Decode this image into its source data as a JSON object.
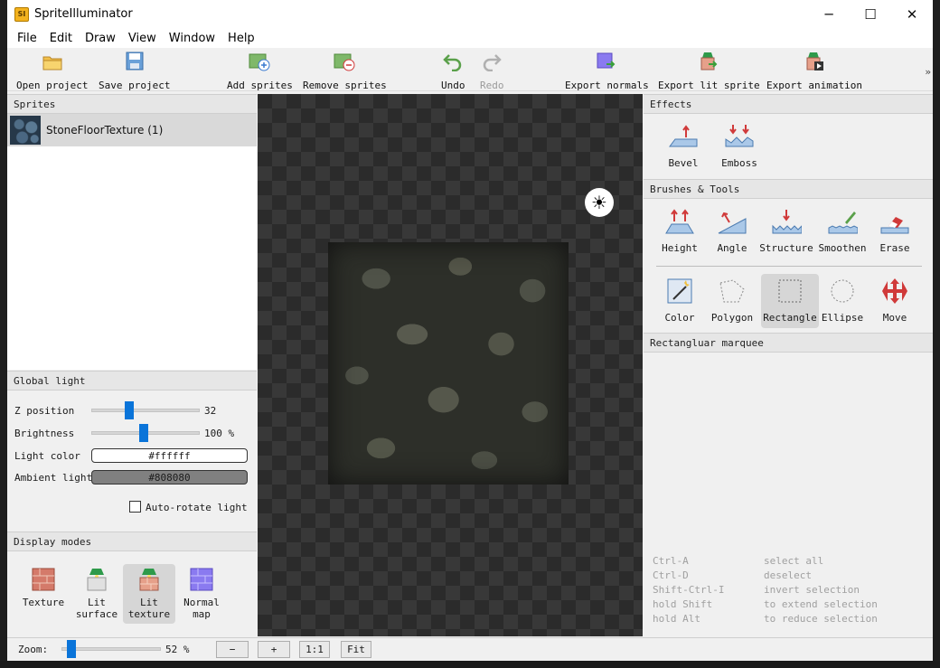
{
  "window": {
    "title": "SpriteIlluminator",
    "minimize": "─",
    "maximize": "☐",
    "close": "✕"
  },
  "menu": [
    "File",
    "Edit",
    "Draw",
    "View",
    "Window",
    "Help"
  ],
  "toolbar": {
    "open": "Open project",
    "save": "Save project",
    "add": "Add sprites",
    "remove": "Remove sprites",
    "undo": "Undo",
    "redo": "Redo",
    "export_normals": "Export normals",
    "export_lit": "Export lit sprite",
    "export_anim": "Export animation",
    "more": "»"
  },
  "sprites": {
    "header": "Sprites",
    "items": [
      {
        "name": "StoneFloorTexture (1)"
      }
    ]
  },
  "global_light": {
    "header": "Global light",
    "z_label": "Z position",
    "z_value": "32",
    "z_level": 0.33,
    "brightness_label": "Brightness",
    "brightness_value": "100 %",
    "brightness_level": 0.48,
    "light_color_label": "Light color",
    "light_color": "#ffffff",
    "ambient_label": "Ambient light",
    "ambient_color": "#808080",
    "auto_rotate": "Auto-rotate light",
    "auto_rotate_checked": false
  },
  "display_modes": {
    "header": "Display modes",
    "items": [
      {
        "label": "Texture"
      },
      {
        "label": "Lit\nsurface"
      },
      {
        "label": "Lit\ntexture",
        "selected": true
      },
      {
        "label": "Normal\nmap"
      }
    ]
  },
  "effects": {
    "header": "Effects",
    "items": [
      "Bevel",
      "Emboss"
    ]
  },
  "brushes": {
    "header": "Brushes & Tools",
    "row1": [
      "Height",
      "Angle",
      "Structure",
      "Smoothen",
      "Erase"
    ],
    "row2": [
      "Color",
      "Polygon",
      "Rectangle",
      "Ellipse",
      "Move"
    ],
    "selected": "Rectangle"
  },
  "marquee": {
    "header": "Rectangluar marquee",
    "shortcuts": [
      {
        "key": "Ctrl-A",
        "action": "select all"
      },
      {
        "key": "Ctrl-D",
        "action": "deselect"
      },
      {
        "key": "Shift-Ctrl-I",
        "action": "invert selection"
      },
      {
        "key": "hold Shift",
        "action": "to extend selection"
      },
      {
        "key": "hold Alt",
        "action": "to reduce selection"
      }
    ]
  },
  "status": {
    "zoom_label": "Zoom:",
    "zoom_value": "52 %",
    "zoom_level": 0.05,
    "minus": "−",
    "plus": "+",
    "one_to_one": "1:1",
    "fit": "Fit"
  },
  "colors": {
    "accent": "#0a74d9",
    "canvas_dark": "#2b2b2b",
    "canvas_light": "#383838"
  }
}
